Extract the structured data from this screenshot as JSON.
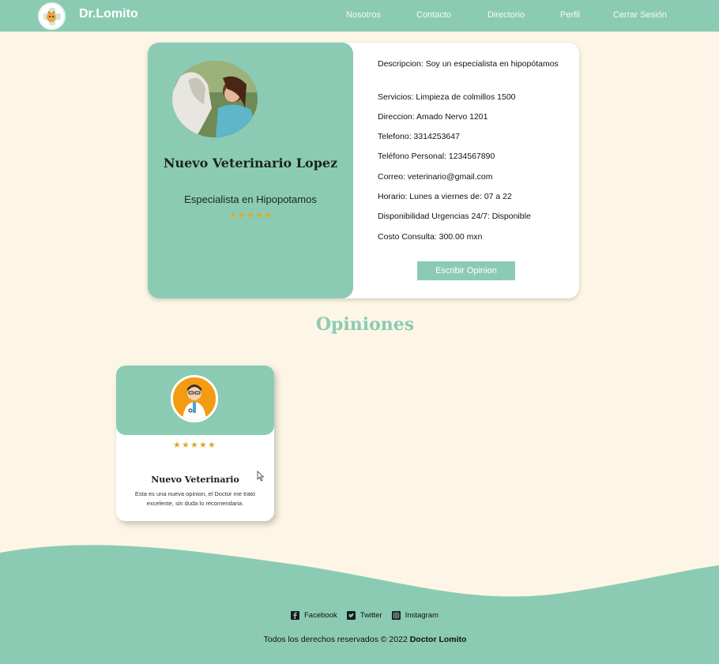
{
  "app": {
    "brand": "Dr.Lomito",
    "colors": {
      "primary": "#8ccbb3",
      "background": "#fdf6e6",
      "star": "#e2a725",
      "avatar_bg": "#f39c12"
    }
  },
  "nav": {
    "links": [
      "Nosotros",
      "Contacto",
      "Directorio",
      "Perfil",
      "Cerrar Sesión"
    ]
  },
  "profile": {
    "name": "Nuevo Veterinario Lopez",
    "specialty": "Especialista en Hipopotamos",
    "rating": 5,
    "info": [
      "Descripcion: Soy un especialista en hipopótamos",
      "Servicios: Limpieza de colmillos 1500",
      "Direccion: Amado Nervo 1201",
      "Telefono: 3314253647",
      "Teléfono Personal: 1234567890",
      "Correo: veterinario@gmail.com",
      "Horario: Lunes a viernes de: 07 a 22",
      "Disponibilidad Urgencias 24/7: Disponible",
      "Costo Consulta: 300.00 mxn"
    ],
    "write_button": "Escribir Opinion"
  },
  "opinions": {
    "title": "Opiniones",
    "items": [
      {
        "author": "Nuevo Veterinario",
        "rating": 5,
        "text": "Esta es una nueva opinion, el Doctor me trató excelente, sin duda lo recomendaria."
      }
    ]
  },
  "footer": {
    "social": [
      {
        "label": "Facebook",
        "icon": "facebook-icon"
      },
      {
        "label": "Twitter",
        "icon": "twitter-icon"
      },
      {
        "label": "Instagram",
        "icon": "instagram-icon"
      }
    ],
    "copyright_prefix": "Todos los derechos reservados © 2022",
    "copyright_brand": "Doctor Lomito"
  }
}
